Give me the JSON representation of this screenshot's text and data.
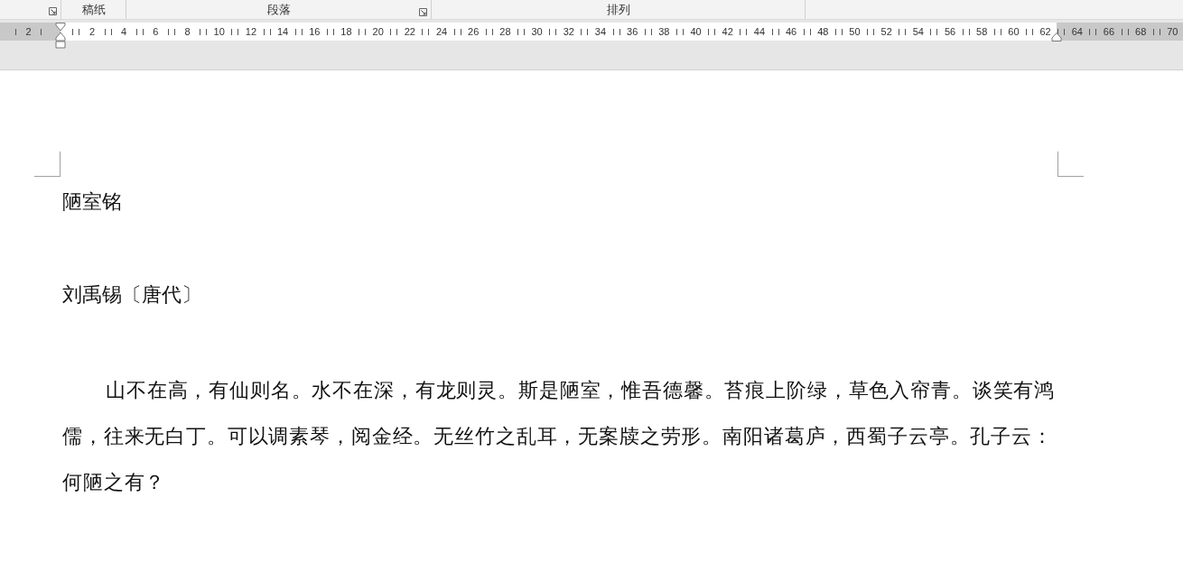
{
  "ribbon": {
    "groups": [
      {
        "label": "稿纸",
        "launcher": false
      },
      {
        "label": "段落",
        "launcher": true
      },
      {
        "label": "排列",
        "launcher": false
      }
    ]
  },
  "ruler": {
    "left_margin_labels": [
      "2"
    ],
    "labels": [
      "2",
      "4",
      "6",
      "8",
      "10",
      "12",
      "14",
      "16",
      "18",
      "20",
      "22",
      "24",
      "26",
      "28",
      "30",
      "32",
      "34",
      "36",
      "38",
      "40",
      "42",
      "44",
      "46",
      "48",
      "50",
      "52",
      "54",
      "56",
      "58",
      "60",
      "62"
    ],
    "right_margin_labels": [
      "64",
      "66",
      "68",
      "70"
    ]
  },
  "document": {
    "title": "陋室铭",
    "author": "刘禹锡〔唐代〕",
    "paragraph": "山不在高，有仙则名。水不在深，有龙则灵。斯是陋室，惟吾德馨。苔痕上阶绿，草色入帘青。谈笑有鸿儒，往来无白丁。可以调素琴，阅金经。无丝竹之乱耳，无案牍之劳形。南阳诸葛庐，西蜀子云亭。孔子云：何陋之有？"
  }
}
